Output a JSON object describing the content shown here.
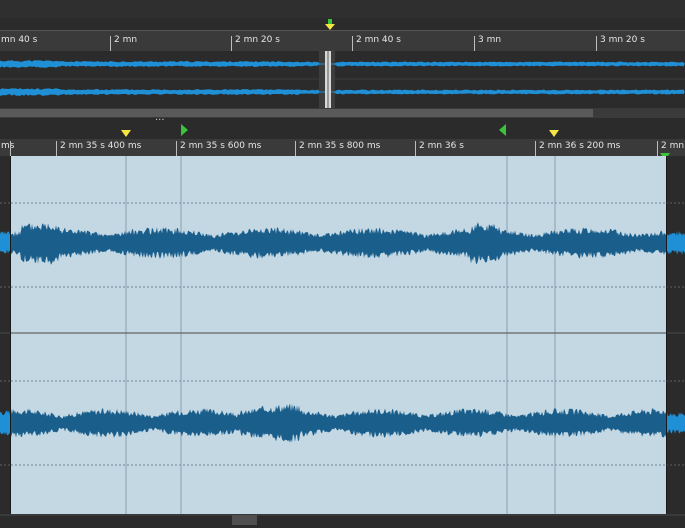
{
  "overview": {
    "ruler_labels": [
      {
        "text": "mn 40 s"
      },
      {
        "text": "2 mn"
      },
      {
        "text": "2 mn 20 s"
      },
      {
        "text": "2 mn 40 s"
      },
      {
        "text": "3 mn"
      },
      {
        "text": "3 mn 20 s"
      }
    ]
  },
  "detail": {
    "ruler_labels": [
      {
        "text": "ms"
      },
      {
        "text": "2 mn 35 s 400 ms"
      },
      {
        "text": "2 mn 35 s 600 ms"
      },
      {
        "text": "2 mn 35 s 800 ms"
      },
      {
        "text": "2 mn 36 s"
      },
      {
        "text": "2 mn 36 s 200 ms"
      },
      {
        "text": "2 mn"
      }
    ]
  },
  "divider_handle": "···",
  "colors": {
    "waveform": "#1f8fd6",
    "selection_bg": "#c3d8e3",
    "detail_wave": "#1a5e8c",
    "marker_yellow": "#f5e642",
    "marker_green": "#3bc43b"
  }
}
